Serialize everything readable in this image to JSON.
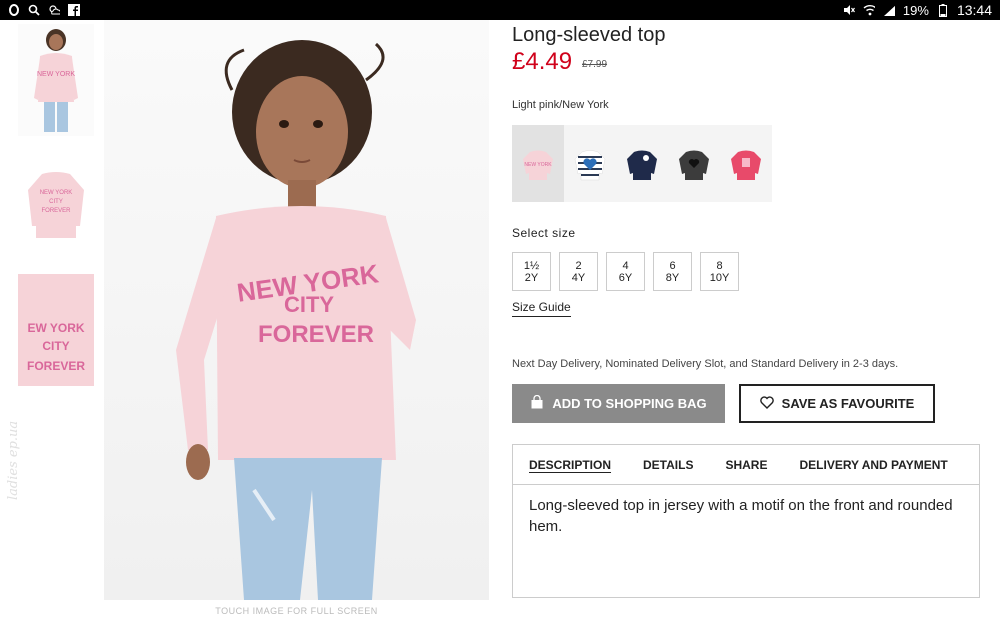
{
  "status_bar": {
    "left_icons": [
      "opera-icon",
      "search-icon",
      "weather-icon",
      "facebook-icon"
    ],
    "right_icons": [
      "mute-icon",
      "wifi-icon",
      "signal-icon"
    ],
    "battery": "19%",
    "time": "13:44"
  },
  "gallery": {
    "caption": "TOUCH IMAGE FOR FULL SCREEN",
    "watermark": "ladies ep.ua"
  },
  "product": {
    "title": "Long-sleeved top",
    "price": "£4.49",
    "old_price": "£7.99",
    "color_name": "Light pink/New York",
    "swatches": [
      "light-pink",
      "striped",
      "navy",
      "dark-grey",
      "pink"
    ],
    "select_size_label": "Select size",
    "sizes": [
      {
        "line1": "1½",
        "line2": "2Y"
      },
      {
        "line1": "2",
        "line2": "4Y"
      },
      {
        "line1": "4",
        "line2": "6Y"
      },
      {
        "line1": "6",
        "line2": "8Y"
      },
      {
        "line1": "8",
        "line2": "10Y"
      }
    ],
    "size_guide": "Size Guide",
    "delivery": "Next Day Delivery, Nominated Delivery Slot, and Standard Delivery in 2-3 days.",
    "add_to_bag": "ADD TO SHOPPING BAG",
    "save_favourite": "SAVE AS FAVOURITE",
    "tabs": [
      "DESCRIPTION",
      "DETAILS",
      "SHARE",
      "DELIVERY AND PAYMENT"
    ],
    "description": "Long-sleeved top in jersey with a motif on the front and rounded hem."
  },
  "colors": {
    "price_red": "#d0021b",
    "bag_button": "#8a8a8a",
    "shirt_pink": "#f6d3d8",
    "print_pink": "#d9679a"
  }
}
